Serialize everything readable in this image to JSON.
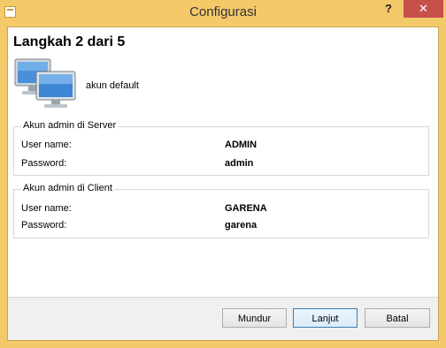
{
  "window": {
    "title": "Configurasi",
    "help_label": "?",
    "close_label": "✕"
  },
  "wizard": {
    "step_title": "Langkah 2 dari 5",
    "image_caption": "akun default"
  },
  "server_group": {
    "title": "Akun admin di Server",
    "username_label": "User name:",
    "username_value": "ADMIN",
    "password_label": "Password:",
    "password_value": "admin"
  },
  "client_group": {
    "title": "Akun admin di Client",
    "username_label": "User name:",
    "username_value": "GARENA",
    "password_label": "Password:",
    "password_value": "garena"
  },
  "buttons": {
    "back": "Mundur",
    "next": "Lanjut",
    "cancel": "Batal"
  },
  "icons": {
    "app": "app-window-icon",
    "computers": "network-computers-icon"
  }
}
